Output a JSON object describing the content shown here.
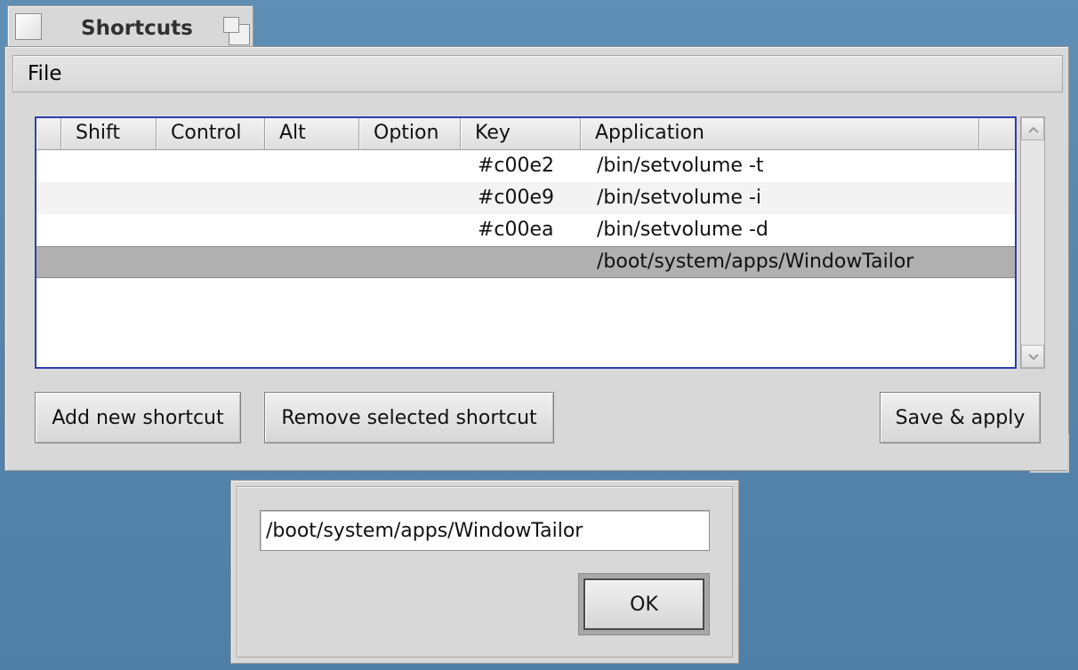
{
  "window": {
    "title": "Shortcuts"
  },
  "menu": {
    "file": "File"
  },
  "table": {
    "columns": [
      "",
      "Shift",
      "Control",
      "Alt",
      "Option",
      "Key",
      "Application"
    ],
    "rows": [
      {
        "shift": "",
        "control": "",
        "alt": "",
        "option": "",
        "key": "#c00e2",
        "application": "/bin/setvolume -t"
      },
      {
        "shift": "",
        "control": "",
        "alt": "",
        "option": "",
        "key": "#c00e9",
        "application": "/bin/setvolume -i"
      },
      {
        "shift": "",
        "control": "",
        "alt": "",
        "option": "",
        "key": "#c00ea",
        "application": "/bin/setvolume -d"
      },
      {
        "shift": "",
        "control": "",
        "alt": "",
        "option": "",
        "key": "",
        "application": "/boot/system/apps/WindowTailor",
        "selected": true
      }
    ]
  },
  "buttons": {
    "add": "Add new shortcut",
    "remove": "Remove selected shortcut",
    "save": "Save & apply"
  },
  "dialog": {
    "path_value": "/boot/system/apps/WindowTailor",
    "ok": "OK"
  },
  "icons": {
    "close": "close-box-icon",
    "zoom": "zoom-box-icon",
    "scroll_up": "chevron-up-icon",
    "scroll_down": "chevron-down-icon"
  },
  "colors": {
    "desktop": "#5f8fb4",
    "window": "#d8d8d8",
    "focus_border": "#2a3fb0",
    "selected_row": "#b0b0b0"
  }
}
